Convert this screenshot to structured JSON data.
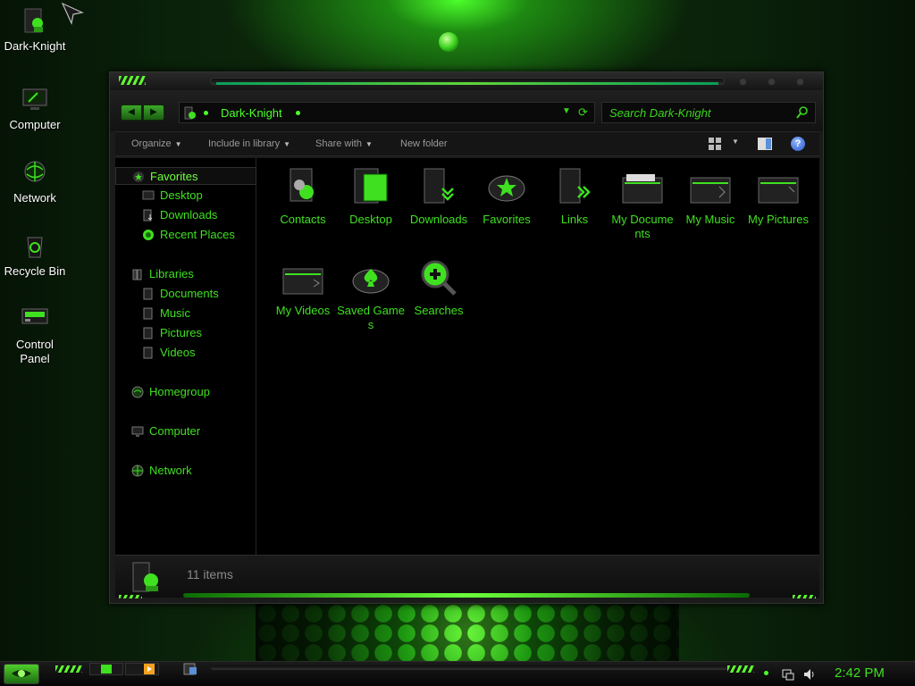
{
  "desktop": {
    "icons": [
      {
        "label": "Dark-Knight",
        "icon": "user-folder-icon"
      },
      {
        "label": "Computer",
        "icon": "computer-icon"
      },
      {
        "label": "Network",
        "icon": "network-globe-icon"
      },
      {
        "label": "Recycle Bin",
        "icon": "recycle-bin-icon"
      },
      {
        "label": "Control Panel",
        "icon": "control-panel-icon"
      }
    ]
  },
  "window": {
    "address": {
      "crumb": "Dark-Knight"
    },
    "search": {
      "placeholder": "Search Dark-Knight"
    },
    "toolbar": {
      "organize": "Organize",
      "include_in_library": "Include in library",
      "share_with": "Share with",
      "new_folder": "New folder"
    },
    "nav": {
      "favorites": "Favorites",
      "desktop": "Desktop",
      "downloads": "Downloads",
      "recent_places": "Recent Places",
      "libraries": "Libraries",
      "documents": "Documents",
      "music": "Music",
      "pictures": "Pictures",
      "videos": "Videos",
      "homegroup": "Homegroup",
      "computer": "Computer",
      "network": "Network"
    },
    "files": [
      {
        "label": "Contacts",
        "icon": "contacts-folder-icon"
      },
      {
        "label": "Desktop",
        "icon": "desktop-folder-icon"
      },
      {
        "label": "Downloads",
        "icon": "downloads-folder-icon"
      },
      {
        "label": "Favorites",
        "icon": "favorites-star-icon"
      },
      {
        "label": "Links",
        "icon": "links-folder-icon"
      },
      {
        "label": "My Documents",
        "icon": "documents-folder-icon"
      },
      {
        "label": "My Music",
        "icon": "music-folder-icon"
      },
      {
        "label": "My Pictures",
        "icon": "pictures-folder-icon"
      },
      {
        "label": "My Videos",
        "icon": "videos-folder-icon"
      },
      {
        "label": "Saved Games",
        "icon": "saved-games-icon"
      },
      {
        "label": "Searches",
        "icon": "searches-icon"
      }
    ],
    "status": {
      "count": "11 items"
    }
  },
  "taskbar": {
    "clock": "2:42 PM"
  },
  "colors": {
    "accent": "#3fe020",
    "accent_bright": "#6dff3c",
    "window_bg": "#000000",
    "chrome": "#1b1b1b"
  }
}
